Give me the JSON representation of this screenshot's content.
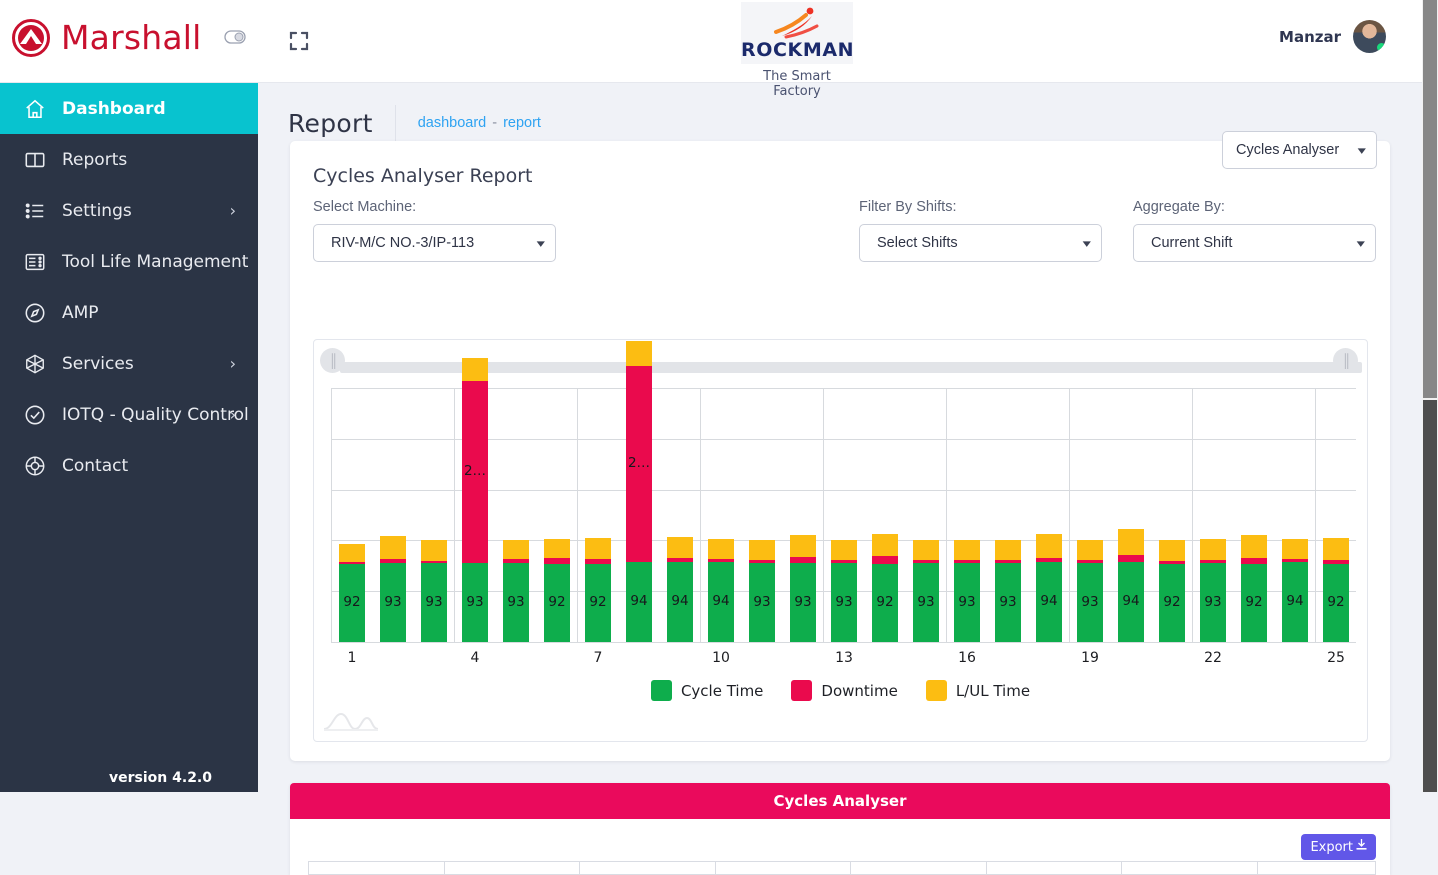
{
  "header": {
    "brand": "Marshall",
    "toggle_icon": "toggle-switch-icon",
    "expand_icon": "fullscreen-expand-icon",
    "company_logo_word": "ROCKMAN",
    "company_tagline": "The Smart Factory",
    "user_name": "Manzar"
  },
  "sidebar": {
    "version": "version 4.2.0",
    "items": [
      {
        "label": "Dashboard",
        "icon": "home-icon",
        "active": true,
        "chevron": false
      },
      {
        "label": "Reports",
        "icon": "book-icon",
        "active": false,
        "chevron": false
      },
      {
        "label": "Settings",
        "icon": "list-settings-icon",
        "active": false,
        "chevron": true
      },
      {
        "label": "Tool Life Management",
        "icon": "server-rack-icon",
        "active": false,
        "chevron": false
      },
      {
        "label": "AMP",
        "icon": "compass-icon",
        "active": false,
        "chevron": false
      },
      {
        "label": "Services",
        "icon": "network-icon",
        "active": false,
        "chevron": true
      },
      {
        "label": "IOTQ - Quality Control",
        "icon": "check-circle-icon",
        "active": false,
        "chevron": true
      },
      {
        "label": "Contact",
        "icon": "lifebuoy-icon",
        "active": false,
        "chevron": false
      }
    ]
  },
  "page": {
    "title": "Report",
    "breadcrumb_first": "dashboard",
    "breadcrumb_sep": "-",
    "breadcrumb_last": "report"
  },
  "report": {
    "card_title": "Cycles Analyser Report",
    "report_type_value": "Cycles Analyser",
    "filters": [
      {
        "label": "Select Machine:",
        "value": "RIV-M/C NO.-3/IP-113"
      },
      {
        "label": "Filter By Shifts:",
        "value": "Select Shifts"
      },
      {
        "label": "Aggregate By:",
        "value": "Current Shift"
      }
    ]
  },
  "bottom_panel": {
    "title": "Cycles Analyser",
    "export_label": "Export",
    "export_icon": "download-icon"
  },
  "colors": {
    "cycle_time": "#0ead4c",
    "downtime": "#ea0a4d",
    "lul_time": "#fcbd12",
    "accent_teal": "#08c3cf",
    "sidebar_bg": "#2b3445",
    "brand_red": "#c8102e",
    "link_blue": "#2ea3f2",
    "export_purple": "#6157e8"
  },
  "chart_data": {
    "type": "bar",
    "stacked": true,
    "title": "",
    "xlabel": "",
    "ylabel": "",
    "grid": true,
    "legend_position": "bottom",
    "ylim": [
      0,
      300
    ],
    "categories": [
      "1",
      "2",
      "3",
      "4",
      "5",
      "6",
      "7",
      "8",
      "9",
      "10",
      "11",
      "12",
      "13",
      "14",
      "15",
      "16",
      "17",
      "18",
      "19",
      "20",
      "21",
      "22",
      "23",
      "24",
      "25"
    ],
    "xtick_labels": [
      "1",
      "4",
      "7",
      "10",
      "13",
      "16",
      "19",
      "22",
      "25"
    ],
    "series": [
      {
        "name": "Cycle Time",
        "color": "#0ead4c",
        "values": [
          92,
          93,
          93,
          93,
          93,
          92,
          92,
          94,
          94,
          94,
          93,
          93,
          93,
          92,
          93,
          93,
          93,
          94,
          93,
          94,
          92,
          93,
          92,
          94,
          92
        ],
        "labels": [
          "92",
          "93",
          "93",
          "93",
          "93",
          "92",
          "92",
          "94",
          "94",
          "94",
          "93",
          "93",
          "93",
          "92",
          "93",
          "93",
          "93",
          "94",
          "93",
          "94",
          "92",
          "93",
          "92",
          "94",
          "92"
        ]
      },
      {
        "name": "Downtime",
        "color": "#ea0a4d",
        "values": [
          3,
          5,
          3,
          215,
          5,
          7,
          6,
          232,
          5,
          4,
          4,
          7,
          4,
          9,
          4,
          4,
          4,
          5,
          4,
          9,
          4,
          4,
          7,
          4,
          5
        ],
        "labels": [
          "",
          "",
          "",
          "2…",
          "",
          "",
          "",
          "2…",
          "",
          "",
          "",
          "",
          "",
          "",
          "",
          "",
          "",
          "",
          "",
          "",
          "",
          "",
          "",
          "",
          ""
        ]
      },
      {
        "name": "L/UL Time",
        "color": "#fcbd12",
        "values": [
          21,
          27,
          24,
          28,
          23,
          23,
          25,
          30,
          25,
          24,
          23,
          26,
          24,
          26,
          24,
          24,
          23,
          28,
          24,
          30,
          25,
          25,
          27,
          24,
          26
        ]
      }
    ],
    "legend": [
      {
        "label": "Cycle Time",
        "color": "#0ead4c"
      },
      {
        "label": "Downtime",
        "color": "#ea0a4d"
      },
      {
        "label": "L/UL Time",
        "color": "#fcbd12"
      }
    ]
  }
}
